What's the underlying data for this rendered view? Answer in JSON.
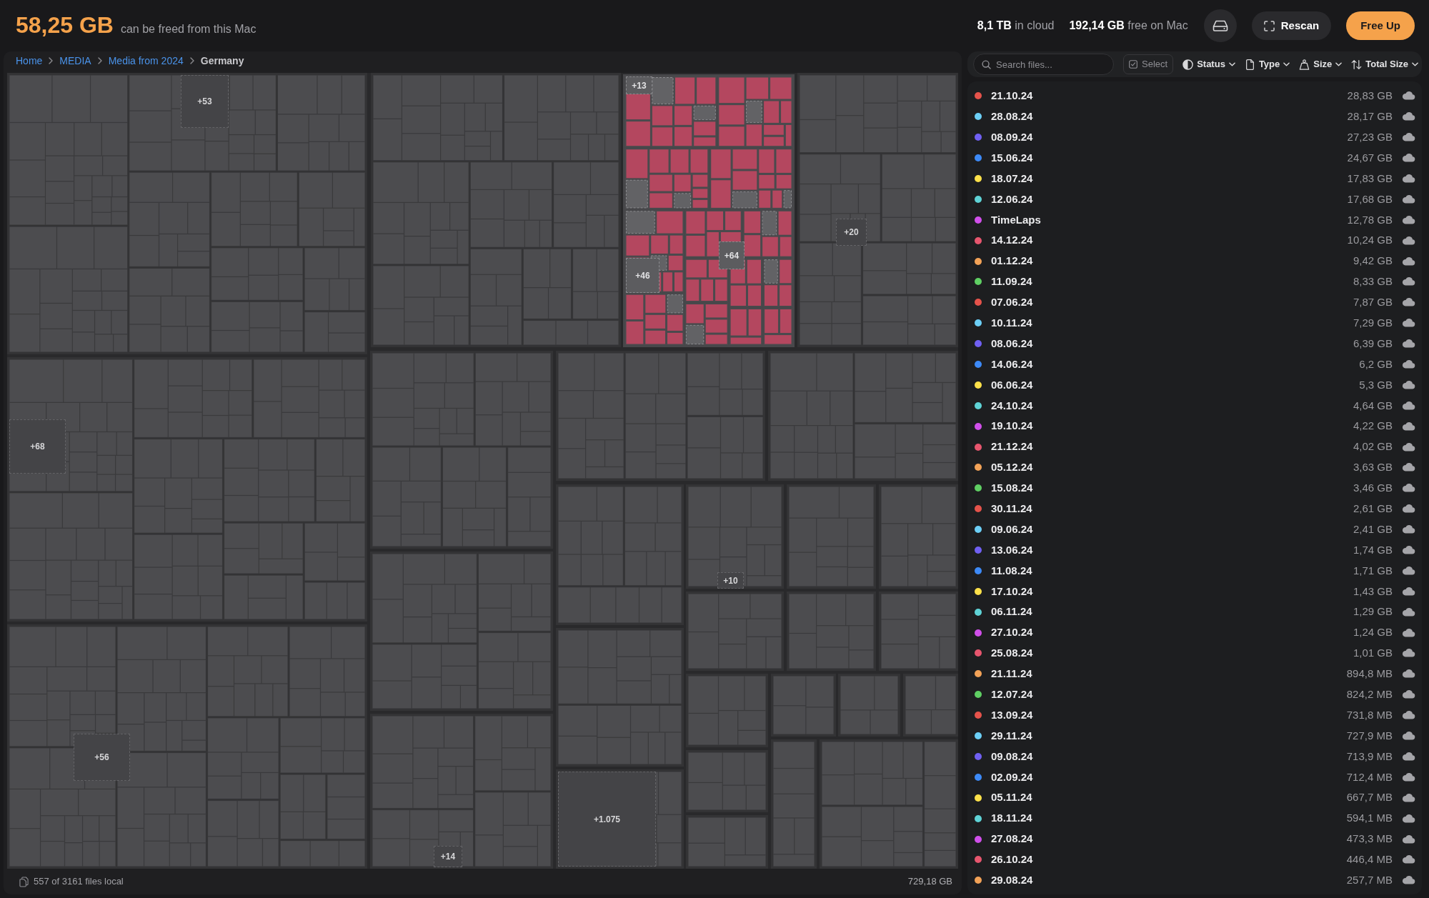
{
  "header": {
    "freeable": "58,25 GB",
    "caption": "can be freed from this Mac",
    "cloud": "**8,1 TB** in cloud",
    "free": "**192,14 GB** free on Mac",
    "buttons": [
      {
        "kind": "drive"
      },
      {
        "kind": "rescan",
        "label": "Rescan"
      },
      {
        "kind": "primary",
        "label": "Free Up"
      }
    ]
  },
  "breadcrumb": [
    {
      "label": "Home",
      "current": false
    },
    {
      "label": "MEDIA",
      "current": false
    },
    {
      "label": "Media from 2024",
      "current": false
    },
    {
      "label": "Germany",
      "current": true
    }
  ],
  "treemap": {
    "blocks": [
      {
        "highlighted": false,
        "overflow": [
          "+53"
        ]
      },
      {
        "highlighted": false
      },
      {
        "highlighted": true,
        "overflow": [
          "+13",
          "+46",
          "+64"
        ]
      },
      {
        "highlighted": false,
        "overflow": [
          "+20"
        ]
      },
      {
        "highlighted": false,
        "overflow": [
          "+68"
        ]
      },
      {
        "highlighted": false,
        "overflow": [
          "+56"
        ]
      },
      {
        "highlighted": false
      },
      {
        "highlighted": false
      },
      {
        "highlighted": false,
        "overflow": [
          "+14"
        ]
      },
      {
        "highlighted": false
      },
      {
        "highlighted": false
      },
      {
        "highlighted": false
      },
      {
        "highlighted": false,
        "overflow": [
          "+10"
        ]
      },
      {
        "highlighted": false
      },
      {
        "highlighted": false
      },
      {
        "highlighted": false
      },
      {
        "highlighted": false
      },
      {
        "highlighted": false
      },
      {
        "highlighted": false
      },
      {
        "highlighted": false,
        "overflow": [
          "+1.075"
        ]
      },
      {
        "highlighted": false
      },
      {
        "highlighted": false
      },
      {
        "highlighted": false
      },
      {
        "highlighted": false
      },
      {
        "highlighted": false
      },
      {
        "highlighted": false
      },
      {
        "highlighted": false
      },
      {
        "highlighted": false
      }
    ]
  },
  "status_bar": {
    "files": "557 of 3161 files local",
    "total": "729,18 GB"
  },
  "toolbar": {
    "search": {
      "placeholder": "Search files..."
    },
    "controls": [
      {
        "kind": "select",
        "label": "Select"
      },
      {
        "kind": "status",
        "label": "Status"
      },
      {
        "kind": "type",
        "label": "Type"
      },
      {
        "kind": "size",
        "label": "Size"
      },
      {
        "kind": "sort",
        "label": "Total Size"
      }
    ]
  },
  "files": [
    {
      "name": "21.10.24",
      "size": "28,83 GB",
      "color": "#e5534b"
    },
    {
      "name": "28.08.24",
      "size": "28,17 GB",
      "color": "#6ccff6"
    },
    {
      "name": "08.09.24",
      "size": "27,23 GB",
      "color": "#7060f2"
    },
    {
      "name": "15.06.24",
      "size": "24,67 GB",
      "color": "#3d8af7"
    },
    {
      "name": "18.07.24",
      "size": "17,83 GB",
      "color": "#fde14a"
    },
    {
      "name": "12.06.24",
      "size": "17,68 GB",
      "color": "#5fd3d6"
    },
    {
      "name": "TimeLaps",
      "size": "12,78 GB",
      "color": "#d04fea"
    },
    {
      "name": "14.12.24",
      "size": "10,24 GB",
      "color": "#e7566e"
    },
    {
      "name": "01.12.24",
      "size": "9,42 GB",
      "color": "#f2a257"
    },
    {
      "name": "11.09.24",
      "size": "8,33 GB",
      "color": "#5fcf63"
    },
    {
      "name": "07.06.24",
      "size": "7,87 GB",
      "color": "#e5534b"
    },
    {
      "name": "10.11.24",
      "size": "7,29 GB",
      "color": "#6ccff6"
    },
    {
      "name": "08.06.24",
      "size": "6,39 GB",
      "color": "#7060f2"
    },
    {
      "name": "14.06.24",
      "size": "6,2 GB",
      "color": "#3d8af7"
    },
    {
      "name": "06.06.24",
      "size": "5,3 GB",
      "color": "#fde14a"
    },
    {
      "name": "24.10.24",
      "size": "4,64 GB",
      "color": "#5fd3d6"
    },
    {
      "name": "19.10.24",
      "size": "4,22 GB",
      "color": "#d04fea"
    },
    {
      "name": "21.12.24",
      "size": "4,02 GB",
      "color": "#e7566e"
    },
    {
      "name": "05.12.24",
      "size": "3,63 GB",
      "color": "#f2a257"
    },
    {
      "name": "15.08.24",
      "size": "3,46 GB",
      "color": "#5fcf63"
    },
    {
      "name": "30.11.24",
      "size": "2,61 GB",
      "color": "#e5534b"
    },
    {
      "name": "09.06.24",
      "size": "2,41 GB",
      "color": "#6ccff6"
    },
    {
      "name": "13.06.24",
      "size": "1,74 GB",
      "color": "#7060f2"
    },
    {
      "name": "11.08.24",
      "size": "1,71 GB",
      "color": "#3d8af7"
    },
    {
      "name": "17.10.24",
      "size": "1,43 GB",
      "color": "#fde14a"
    },
    {
      "name": "06.11.24",
      "size": "1,29 GB",
      "color": "#5fd3d6"
    },
    {
      "name": "27.10.24",
      "size": "1,24 GB",
      "color": "#d04fea"
    },
    {
      "name": "25.08.24",
      "size": "1,01 GB",
      "color": "#e7566e"
    },
    {
      "name": "21.11.24",
      "size": "894,8 MB",
      "color": "#f2a257"
    },
    {
      "name": "12.07.24",
      "size": "824,2 MB",
      "color": "#5fcf63"
    },
    {
      "name": "13.09.24",
      "size": "731,8 MB",
      "color": "#e5534b"
    },
    {
      "name": "29.11.24",
      "size": "727,9 MB",
      "color": "#6ccff6"
    },
    {
      "name": "09.08.24",
      "size": "713,9 MB",
      "color": "#7060f2"
    },
    {
      "name": "02.09.24",
      "size": "712,4 MB",
      "color": "#3d8af7"
    },
    {
      "name": "05.11.24",
      "size": "667,7 MB",
      "color": "#fde14a"
    },
    {
      "name": "18.11.24",
      "size": "594,1 MB",
      "color": "#5fd3d6"
    },
    {
      "name": "27.08.24",
      "size": "473,3 MB",
      "color": "#d04fea"
    },
    {
      "name": "26.10.24",
      "size": "446,4 MB",
      "color": "#e7566e"
    },
    {
      "name": "29.08.24",
      "size": "257,7 MB",
      "color": "#f2a257"
    }
  ]
}
